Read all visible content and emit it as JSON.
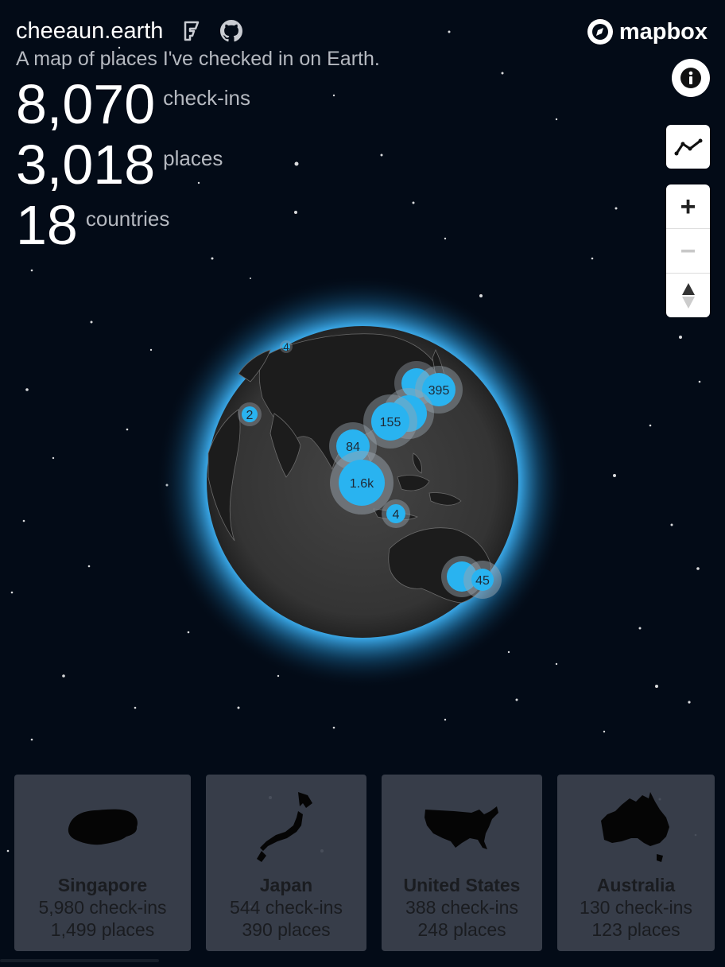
{
  "header": {
    "title": "cheeaun.earth",
    "subtitle": "A map of places I've checked in on Earth.",
    "foursquare_icon": "foursquare-icon",
    "github_icon": "github-icon"
  },
  "stats": [
    {
      "value": "8,070",
      "label": "check-ins"
    },
    {
      "value": "3,018",
      "label": "places"
    },
    {
      "value": "18",
      "label": "countries"
    }
  ],
  "mapbox": {
    "logo_text": "mapbox"
  },
  "controls": {
    "info_icon": "info-icon",
    "line_icon": "line-chart-icon",
    "zoom_in": "+",
    "zoom_out": "−",
    "compass_icon": "compass-icon"
  },
  "clusters": [
    {
      "label": "4",
      "size": "small"
    },
    {
      "label": "2",
      "size": "small"
    },
    {
      "label": "395",
      "size": "medium"
    },
    {
      "label": "155",
      "size": "medium"
    },
    {
      "label": "84",
      "size": "medium"
    },
    {
      "label": "1.6k",
      "size": "large"
    },
    {
      "label": "4",
      "size": "small"
    },
    {
      "label": "45",
      "size": "medium"
    }
  ],
  "countries": [
    {
      "name": "Singapore",
      "checkins": "5,980 check-ins",
      "places": "1,499 places"
    },
    {
      "name": "Japan",
      "checkins": "544 check-ins",
      "places": "390 places"
    },
    {
      "name": "United States",
      "checkins": "388 check-ins",
      "places": "248 places"
    },
    {
      "name": "Australia",
      "checkins": "130 check-ins",
      "places": "123 places"
    }
  ],
  "colors": {
    "background": "#030b17",
    "globe": "#3a3a3a",
    "glow": "#3fb9ff",
    "cluster": "#29b3f0",
    "card": "#3c424e"
  }
}
